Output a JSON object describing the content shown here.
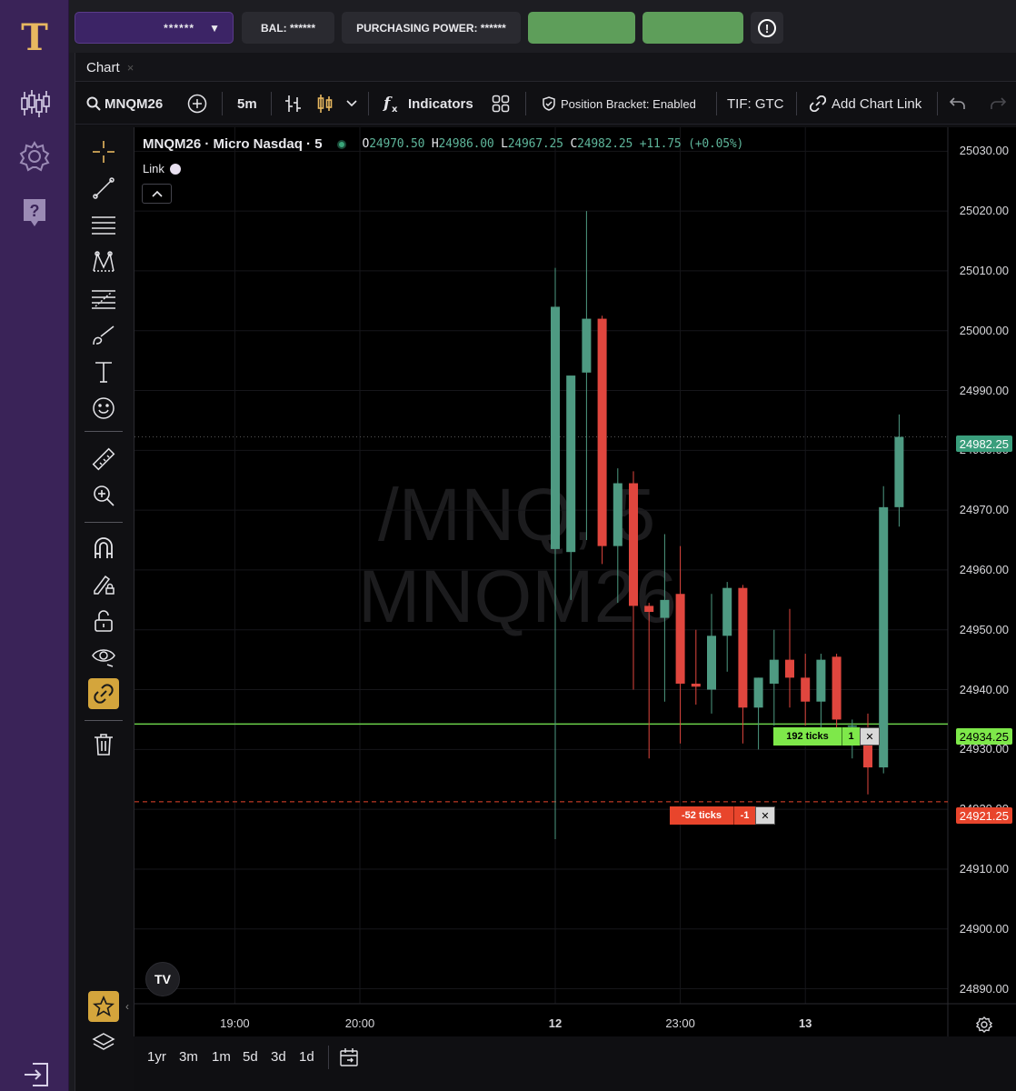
{
  "app": {
    "logo_letter": "T",
    "brand_color": "#e8b860",
    "rail_color": "#3a2358"
  },
  "topbar": {
    "account_value": "******",
    "balance": "BAL: ******",
    "purchasing_power": "PURCHASING POWER: ******",
    "warn_glyph": "!"
  },
  "tabs": [
    {
      "label": "Chart",
      "close": "×"
    }
  ],
  "toolbar": {
    "symbol": "MNQM26",
    "interval": "5m",
    "indicators": "Indicators",
    "position_bracket": "Position Bracket: Enabled",
    "tif": "TIF: GTC",
    "add_chart_link": "Add Chart Link"
  },
  "legend": {
    "title": "MNQM26 · Micro Nasdaq · 5",
    "o_label": "O",
    "o": "24970.50",
    "h_label": "H",
    "h": "24986.00",
    "l_label": "L",
    "l": "24967.25",
    "c_label": "C",
    "c": "24982.25",
    "change": "+11.75 (+0.05%)",
    "link_label": "Link",
    "collapse_glyph": "^"
  },
  "watermark": {
    "line1": "/MNQ, 5",
    "line2": "MNQM26"
  },
  "orders": {
    "target": {
      "ticks": "192 ticks",
      "qty": "1",
      "close": "✕",
      "price": "24934.25",
      "color": "#7ee84a"
    },
    "stop": {
      "ticks": "-52 ticks",
      "qty": "-1",
      "close": "✕",
      "price": "24921.25",
      "color": "#e8452c"
    }
  },
  "last_price": {
    "price": "24982.25",
    "color": "#3a9e7c"
  },
  "range_buttons": [
    "1yr",
    "3m",
    "1m",
    "5d",
    "3d",
    "1d"
  ],
  "tv_logo": "TV",
  "chart_data": {
    "type": "candlestick",
    "symbol": "MNQM26",
    "interval": "5",
    "price_axis": [
      "25030.00",
      "25020.00",
      "25010.00",
      "25000.00",
      "24990.00",
      "24980.00",
      "24970.00",
      "24960.00",
      "24950.00",
      "24940.00",
      "24930.00",
      "24920.00",
      "24910.00",
      "24900.00",
      "24890.00"
    ],
    "ylim": [
      24887.5,
      25034
    ],
    "time_axis": [
      {
        "label": "19:00",
        "slot": -20.5,
        "bold": false
      },
      {
        "label": "20:00",
        "slot": -12.5,
        "bold": false
      },
      {
        "label": "12",
        "slot": 0,
        "bold": true
      },
      {
        "label": "23:00",
        "slot": 8,
        "bold": false
      },
      {
        "label": "13",
        "slot": 16,
        "bold": true
      }
    ],
    "up_color": "#4e9a82",
    "down_color": "#e0463e",
    "candles": [
      {
        "o": 24963.5,
        "h": 25010.5,
        "l": 24915.0,
        "c": 25004.0
      },
      {
        "o": 24963.0,
        "h": 24992.0,
        "l": 24955.0,
        "c": 24992.5
      },
      {
        "o": 24993.0,
        "h": 25020.0,
        "l": 24965.0,
        "c": 25002.0
      },
      {
        "o": 25002.0,
        "h": 25002.5,
        "l": 24961.0,
        "c": 24964.0
      },
      {
        "o": 24964.0,
        "h": 24977.0,
        "l": 24954.5,
        "c": 24974.5
      },
      {
        "o": 24974.5,
        "h": 24976.5,
        "l": 24940.0,
        "c": 24954.0
      },
      {
        "o": 24954.0,
        "h": 24954.5,
        "l": 24928.5,
        "c": 24953.0
      },
      {
        "o": 24952.0,
        "h": 24966.0,
        "l": 24938.0,
        "c": 24955.0
      },
      {
        "o": 24956.0,
        "h": 24964.0,
        "l": 24931.0,
        "c": 24941.0
      },
      {
        "o": 24941.0,
        "h": 24950.0,
        "l": 24937.5,
        "c": 24940.5
      },
      {
        "o": 24940.0,
        "h": 24956.0,
        "l": 24936.0,
        "c": 24949.0
      },
      {
        "o": 24949.0,
        "h": 24958.0,
        "l": 24943.0,
        "c": 24957.0
      },
      {
        "o": 24957.0,
        "h": 24957.5,
        "l": 24931.0,
        "c": 24937.0
      },
      {
        "o": 24937.0,
        "h": 24942.0,
        "l": 24930.0,
        "c": 24942.0
      },
      {
        "o": 24941.0,
        "h": 24950.0,
        "l": 24934.0,
        "c": 24945.0
      },
      {
        "o": 24945.0,
        "h": 24953.5,
        "l": 24937.0,
        "c": 24942.0
      },
      {
        "o": 24942.0,
        "h": 24946.0,
        "l": 24934.0,
        "c": 24938.0
      },
      {
        "o": 24938.0,
        "h": 24946.0,
        "l": 24932.0,
        "c": 24945.0
      },
      {
        "o": 24945.5,
        "h": 24946.0,
        "l": 24933.0,
        "c": 24935.0
      },
      {
        "o": 24934.0,
        "h": 24935.0,
        "l": 24928.5,
        "c": 24934.0
      },
      {
        "o": 24932.0,
        "h": 24936.0,
        "l": 24922.5,
        "c": 24927.0
      },
      {
        "o": 24927.0,
        "h": 24974.0,
        "l": 24926.0,
        "c": 24970.5
      },
      {
        "o": 24970.5,
        "h": 24986.0,
        "l": 24967.25,
        "c": 24982.25
      }
    ],
    "horizontal_lines": [
      {
        "price": 24982.25,
        "style": "dotted",
        "color": "#555"
      },
      {
        "price": 24934.25,
        "style": "solid",
        "color": "#6bd24a"
      },
      {
        "price": 24921.25,
        "style": "dashed",
        "color": "#e8452c"
      }
    ]
  }
}
